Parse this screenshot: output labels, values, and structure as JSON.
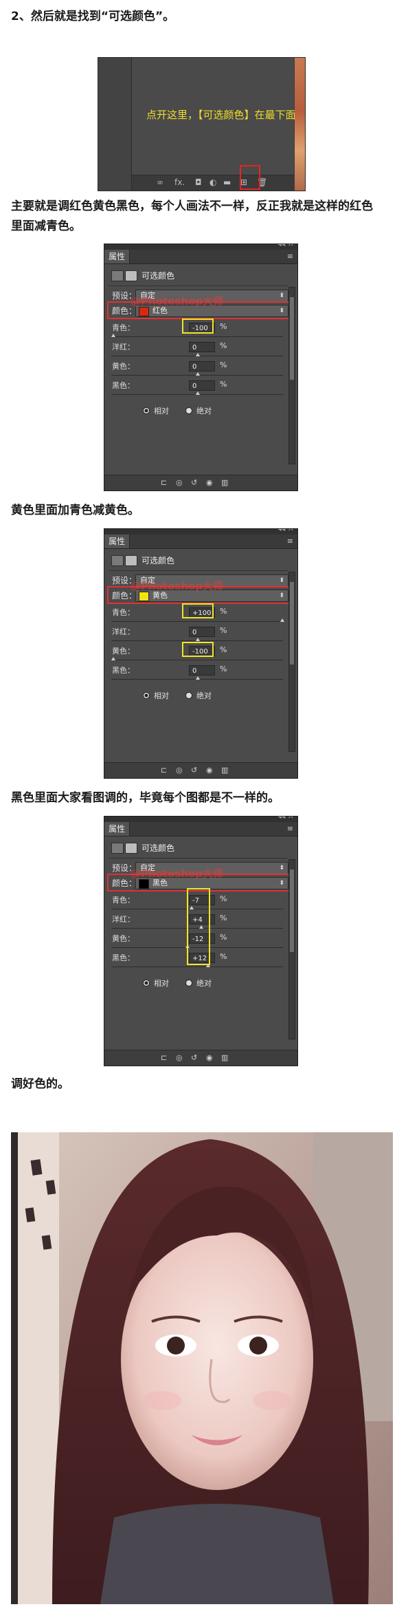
{
  "paragraphs": {
    "p1": "2、然后就是找到“可选颜色”。",
    "p2a": "主要就是调红色黄色黑色，每个人画法不一样，反正我就是这样的红色",
    "p2b": "里面减青色。",
    "p3": "黄色里面加青色减黄色。",
    "p4": "黑色里面大家看图调的，毕竟每个图都是不一样的。",
    "p5": "调好色的。"
  },
  "screenshot1": {
    "hint": "点开这里，【可选颜色】在最下面",
    "bottom_icons": [
      "∞",
      "fx.",
      "◘",
      "◐",
      "▬",
      "⊞",
      "🗑"
    ]
  },
  "colors": {
    "highlight_red": "#e23030",
    "highlight_yellow": "#f0e626",
    "hint_yellow": "#f2de29",
    "panel_bg": "#4b4b4b"
  },
  "panels": [
    {
      "tab": "属性",
      "title": "可选颜色",
      "preset_label": "预设：",
      "preset_value": "自定",
      "color_label": "颜色：",
      "color_value": "红色",
      "swatch": "#d42a10",
      "watermark": "@Photoshop大师",
      "sliders": [
        {
          "label": "青色：",
          "value": "-100",
          "level": 0.0
        },
        {
          "label": "洋红：",
          "value": "0",
          "level": 0.5
        },
        {
          "label": "黄色：",
          "value": "0",
          "level": 0.5
        },
        {
          "label": "黑色：",
          "value": "0",
          "level": 0.5
        }
      ],
      "relative": "相对",
      "absolute": "绝对",
      "method": "relative"
    },
    {
      "tab": "属性",
      "title": "可选颜色",
      "preset_label": "预设：",
      "preset_value": "自定",
      "color_label": "颜色：",
      "color_value": "黄色",
      "swatch": "#f3e40f",
      "watermark": "@Photoshop大师",
      "sliders": [
        {
          "label": "青色：",
          "value": "+100",
          "level": 1.0
        },
        {
          "label": "洋红：",
          "value": "0",
          "level": 0.5
        },
        {
          "label": "黄色：",
          "value": "-100",
          "level": 0.0
        },
        {
          "label": "黑色：",
          "value": "0",
          "level": 0.5
        }
      ],
      "relative": "相对",
      "absolute": "绝对",
      "method": "relative"
    },
    {
      "tab": "属性",
      "title": "可选颜色",
      "preset_label": "预设：",
      "preset_value": "自定",
      "color_label": "颜色：",
      "color_value": "黑色",
      "swatch": "#000000",
      "watermark": "@Photoshop大师",
      "sliders": [
        {
          "label": "青色：",
          "value": "-7",
          "level": 0.465
        },
        {
          "label": "洋红：",
          "value": "+4",
          "level": 0.52
        },
        {
          "label": "黄色：",
          "value": "-12",
          "level": 0.44
        },
        {
          "label": "黑色：",
          "value": "+12",
          "level": 0.56
        }
      ],
      "relative": "相对",
      "absolute": "绝对",
      "method": "relative"
    }
  ]
}
